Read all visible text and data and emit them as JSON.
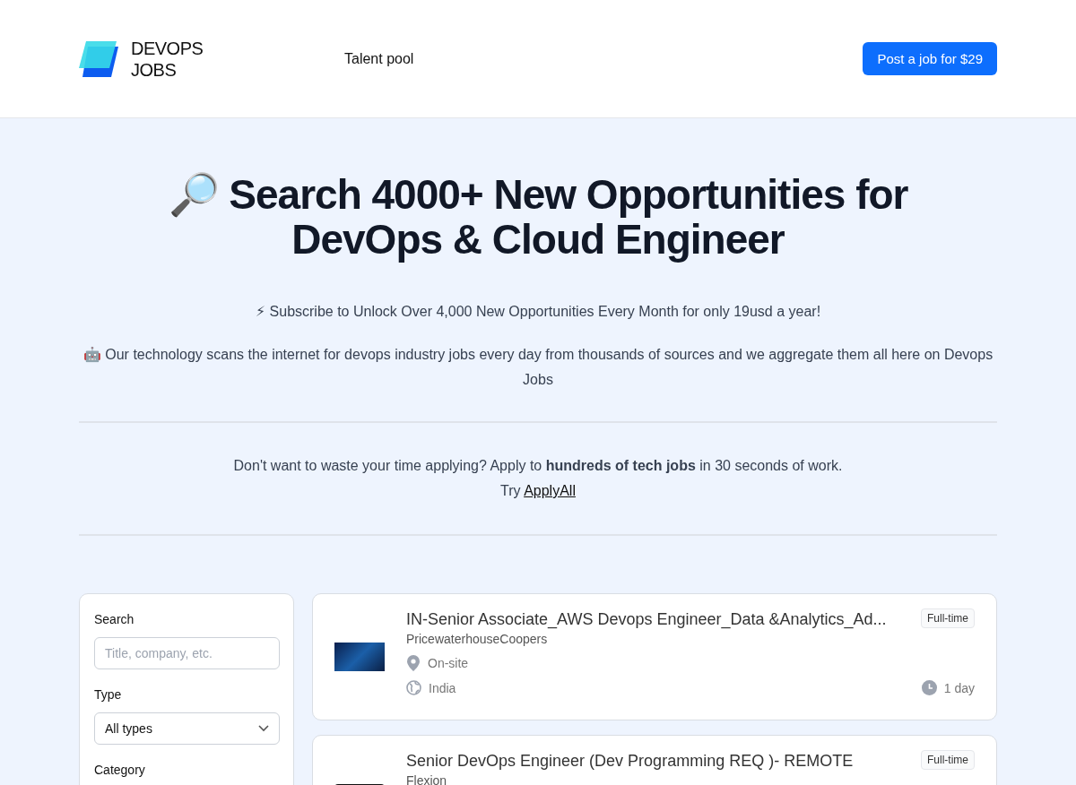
{
  "header": {
    "logo": {
      "line_1": "DEVOPS",
      "line_2": "JOBS"
    },
    "nav": [
      {
        "label": "Talent pool"
      }
    ],
    "cta": "Post a job for $29"
  },
  "hero": {
    "icon": "🔎",
    "title": "Search 4000+ New Opportunities for DevOps & Cloud Engineer",
    "subscribe": "⚡ Subscribe to Unlock Over 4,000 New Opportunities Every Month for only 19usd a year!",
    "about": "🤖 Our technology scans the internet for devops industry jobs every day from thousands of sources and we aggregate them all here on Devops Jobs",
    "promo": {
      "text": "Don't want to waste your time applying? Apply to **hundreds of tech jobs** in 30 seconds of work.",
      "try": "Try",
      "link": "ApplyAll"
    }
  },
  "filters": {
    "search": {
      "label": "Search",
      "placeholder": "Title, company, etc."
    },
    "type": {
      "label": "Type",
      "value": "All types"
    },
    "category": {
      "label": "Category"
    }
  },
  "jobs": [
    {
      "kind": "photo",
      "title": "IN-Senior Associate_AWS Devops Engineer_Data &Analytics_Ad...",
      "company": "PricewaterhouseCoopers",
      "employment": "Full-time",
      "workplace": "On-site",
      "location": "India",
      "posted": "1 day"
    },
    {
      "kind": "brand",
      "title": "Senior DevOps Engineer (Dev Programming REQ )- REMOTE",
      "company": "Flexion",
      "employment": "Full-time"
    }
  ]
}
